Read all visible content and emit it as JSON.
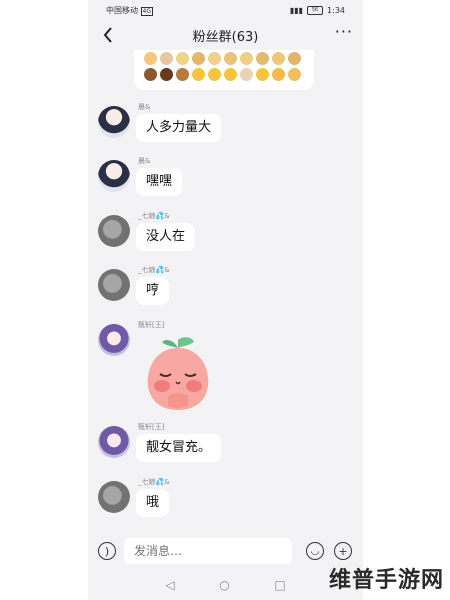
{
  "statusbar": {
    "carrier": "中国移动",
    "network": "4G",
    "battery": "56",
    "time": "1:34"
  },
  "header": {
    "title": "粉丝群(63)",
    "more": "···"
  },
  "messages": [
    {
      "sender": "晨&",
      "text": "人多力量大"
    },
    {
      "sender": "晨&",
      "text": "嘿嘿"
    },
    {
      "sender": "_七娘💦&",
      "text": "没人在"
    },
    {
      "sender": "_七娘💦&",
      "text": "哼"
    },
    {
      "sender": "甄轩[王]",
      "sticker": "peach-sticker"
    },
    {
      "sender": "甄轩[王]",
      "text": "靓女冒充。"
    },
    {
      "sender": "_七娘💦&",
      "text": "哦"
    }
  ],
  "inputbar": {
    "placeholder": "发消息…"
  },
  "watermark": "维普手游网"
}
